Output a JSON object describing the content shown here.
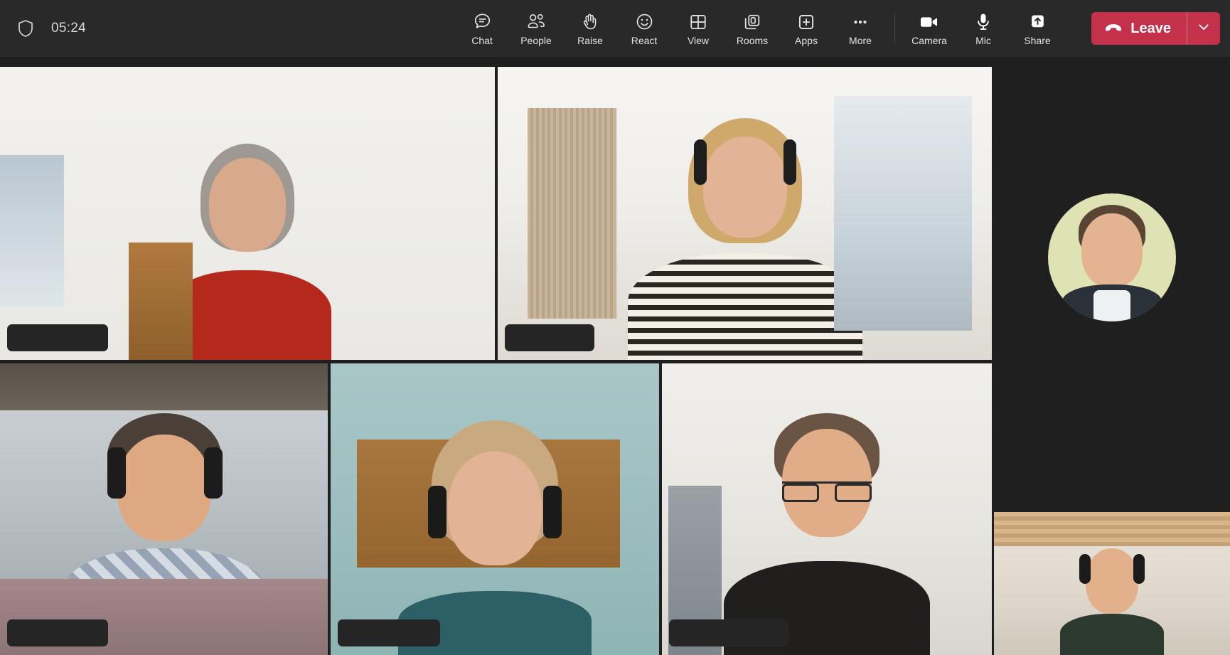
{
  "meeting": {
    "timer": "05:24",
    "security_icon": "shield-icon"
  },
  "toolbar": {
    "items": [
      {
        "label": "Chat",
        "icon": "chat-icon"
      },
      {
        "label": "People",
        "icon": "people-icon"
      },
      {
        "label": "Raise",
        "icon": "raise-hand-icon"
      },
      {
        "label": "React",
        "icon": "react-smiley-icon"
      },
      {
        "label": "View",
        "icon": "view-grid-icon"
      },
      {
        "label": "Rooms",
        "icon": "breakout-rooms-icon"
      },
      {
        "label": "Apps",
        "icon": "apps-plus-icon"
      },
      {
        "label": "More",
        "icon": "more-ellipsis-icon"
      }
    ],
    "device_items": [
      {
        "label": "Camera",
        "icon": "camera-icon",
        "state": "on"
      },
      {
        "label": "Mic",
        "icon": "microphone-icon",
        "state": "on"
      },
      {
        "label": "Share",
        "icon": "share-up-arrow-icon",
        "state": "off"
      }
    ],
    "leave": {
      "label": "Leave",
      "icon": "hangup-phone-icon",
      "caret_icon": "chevron-down-icon",
      "color": "#C4314B"
    }
  },
  "stage": {
    "layout": "gallery",
    "tiles": [
      {
        "id": "tile-1",
        "name_label": "",
        "redacted": true,
        "video": "on",
        "label_width": 142
      },
      {
        "id": "tile-2",
        "name_label": "",
        "redacted": true,
        "video": "on",
        "label_width": 126
      },
      {
        "id": "tile-3",
        "name_label": "",
        "redacted": true,
        "video": "on",
        "label_width": 142
      },
      {
        "id": "tile-4",
        "name_label": "",
        "redacted": true,
        "video": "on",
        "label_width": 144
      },
      {
        "id": "tile-5",
        "name_label": "",
        "redacted": true,
        "video": "on",
        "label_width": 168
      },
      {
        "id": "tile-6",
        "name_label": "",
        "redacted": false,
        "video": "on",
        "label_width": 0
      }
    ],
    "avatar_tile": {
      "id": "avatar-pane",
      "video": "off",
      "avatar_background": "#DFE3B4"
    }
  },
  "colors": {
    "topbar_background": "#292929",
    "stage_background": "#1F1F1F",
    "leave_red": "#C4314B",
    "label_text": "#E3E3E3"
  }
}
